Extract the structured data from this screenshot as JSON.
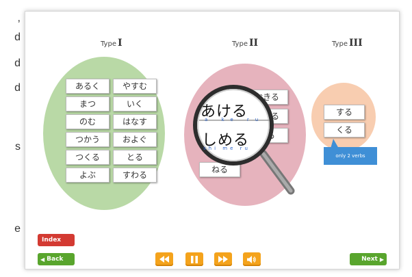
{
  "side_text": [
    ",",
    "d",
    "d",
    "d",
    "s",
    "e"
  ],
  "types": {
    "type1_label": "Type",
    "type1_num": "I",
    "type2_label": "Type",
    "type2_num": "II",
    "type3_label": "Type",
    "type3_num": "III"
  },
  "type1_verbs": [
    "あるく",
    "やすむ",
    "まつ",
    "いく",
    "のむ",
    "はなす",
    "つかう",
    "およぐ",
    "つくる",
    "とる",
    "よぶ",
    "すわる"
  ],
  "type2_verbs": [
    "おきる",
    "かりる",
    "みる",
    "ねる"
  ],
  "magnifier": {
    "word1": "あける",
    "word1_romaji": "a ke ru",
    "word2": "しめる",
    "word2_romaji": "shi me ru"
  },
  "type3_verbs": [
    "する",
    "くる"
  ],
  "tooltip": "only 2 verbs",
  "nav": {
    "index_label": "Index",
    "back_label": "Back",
    "next_label": "Next"
  },
  "media": {
    "rewind": "rewind-icon",
    "pause": "pause-icon",
    "forward": "fast-forward-icon",
    "volume": "volume-icon"
  },
  "colors": {
    "type1_oval": "#b9d9a6",
    "type2_oval": "#e6b3bd",
    "type3_oval": "#f8cdb0",
    "media_orange": "#f4a31c",
    "index_red": "#d33a32",
    "nav_green": "#59a52d",
    "tooltip_blue": "#3f8fd6"
  }
}
